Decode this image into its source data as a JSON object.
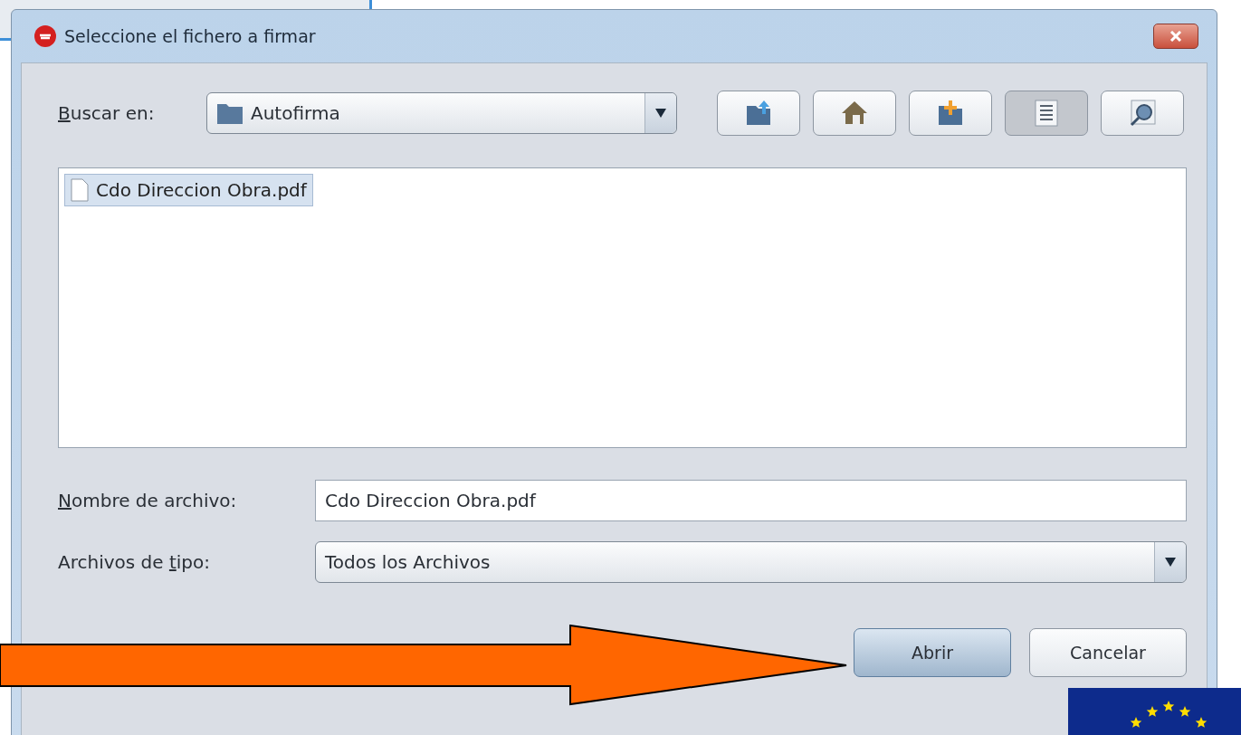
{
  "window": {
    "title": "Seleccione el fichero a firmar"
  },
  "look_in": {
    "label": [
      {
        "text": "B",
        "underlined": true
      },
      {
        "text": "uscar en:",
        "underlined": false
      }
    ],
    "value": "Autofirma"
  },
  "toolbar": [
    {
      "kind": "up",
      "selected": false
    },
    {
      "kind": "home",
      "selected": false
    },
    {
      "kind": "new-folder",
      "selected": false
    },
    {
      "kind": "list",
      "selected": true
    },
    {
      "kind": "details",
      "selected": false
    }
  ],
  "files": [
    {
      "name": "Cdo Direccion Obra.pdf",
      "selected": true
    }
  ],
  "file_name": {
    "label": [
      {
        "text": "N",
        "underlined": true
      },
      {
        "text": "ombre de archivo:",
        "underlined": false
      }
    ],
    "value": "Cdo Direccion Obra.pdf"
  },
  "file_type": {
    "label": [
      {
        "text": "Archivos de ",
        "underlined": false
      },
      {
        "text": "t",
        "underlined": true
      },
      {
        "text": "ipo:",
        "underlined": false
      }
    ],
    "value": "Todos los Archivos"
  },
  "buttons": [
    {
      "label": "Abrir",
      "kind": "default"
    },
    {
      "label": "Cancelar",
      "kind": "normal"
    }
  ]
}
